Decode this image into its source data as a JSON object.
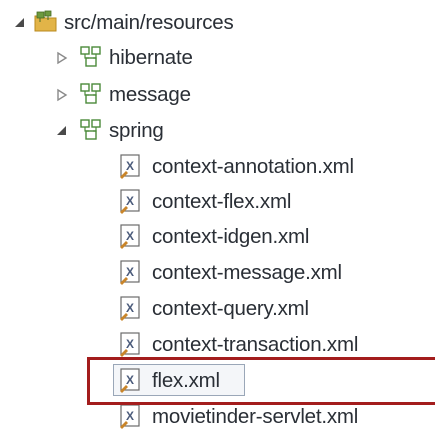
{
  "tree": {
    "root": {
      "label": "src/main/resources",
      "icon": "source-folder-icon",
      "state": "expanded"
    },
    "packages": [
      {
        "label": "hibernate",
        "icon": "package-icon",
        "state": "collapsed"
      },
      {
        "label": "message",
        "icon": "package-icon",
        "state": "collapsed"
      },
      {
        "label": "spring",
        "icon": "package-icon",
        "state": "expanded"
      }
    ],
    "spring_files": [
      {
        "label": "context-annotation.xml",
        "icon": "xml-file-icon"
      },
      {
        "label": "context-flex.xml",
        "icon": "xml-file-icon"
      },
      {
        "label": "context-idgen.xml",
        "icon": "xml-file-icon"
      },
      {
        "label": "context-message.xml",
        "icon": "xml-file-icon"
      },
      {
        "label": "context-query.xml",
        "icon": "xml-file-icon"
      },
      {
        "label": "context-transaction.xml",
        "icon": "xml-file-icon"
      },
      {
        "label": "flex.xml",
        "icon": "xml-file-icon",
        "selected": true,
        "highlighted": true
      },
      {
        "label": "movietinder-servlet.xml",
        "icon": "xml-file-icon"
      }
    ]
  },
  "colors": {
    "highlight_border": "#a31d1d",
    "text": "#2a2f36",
    "package_icon": "#4b8a3a",
    "folder_icon": "#e2b448"
  }
}
